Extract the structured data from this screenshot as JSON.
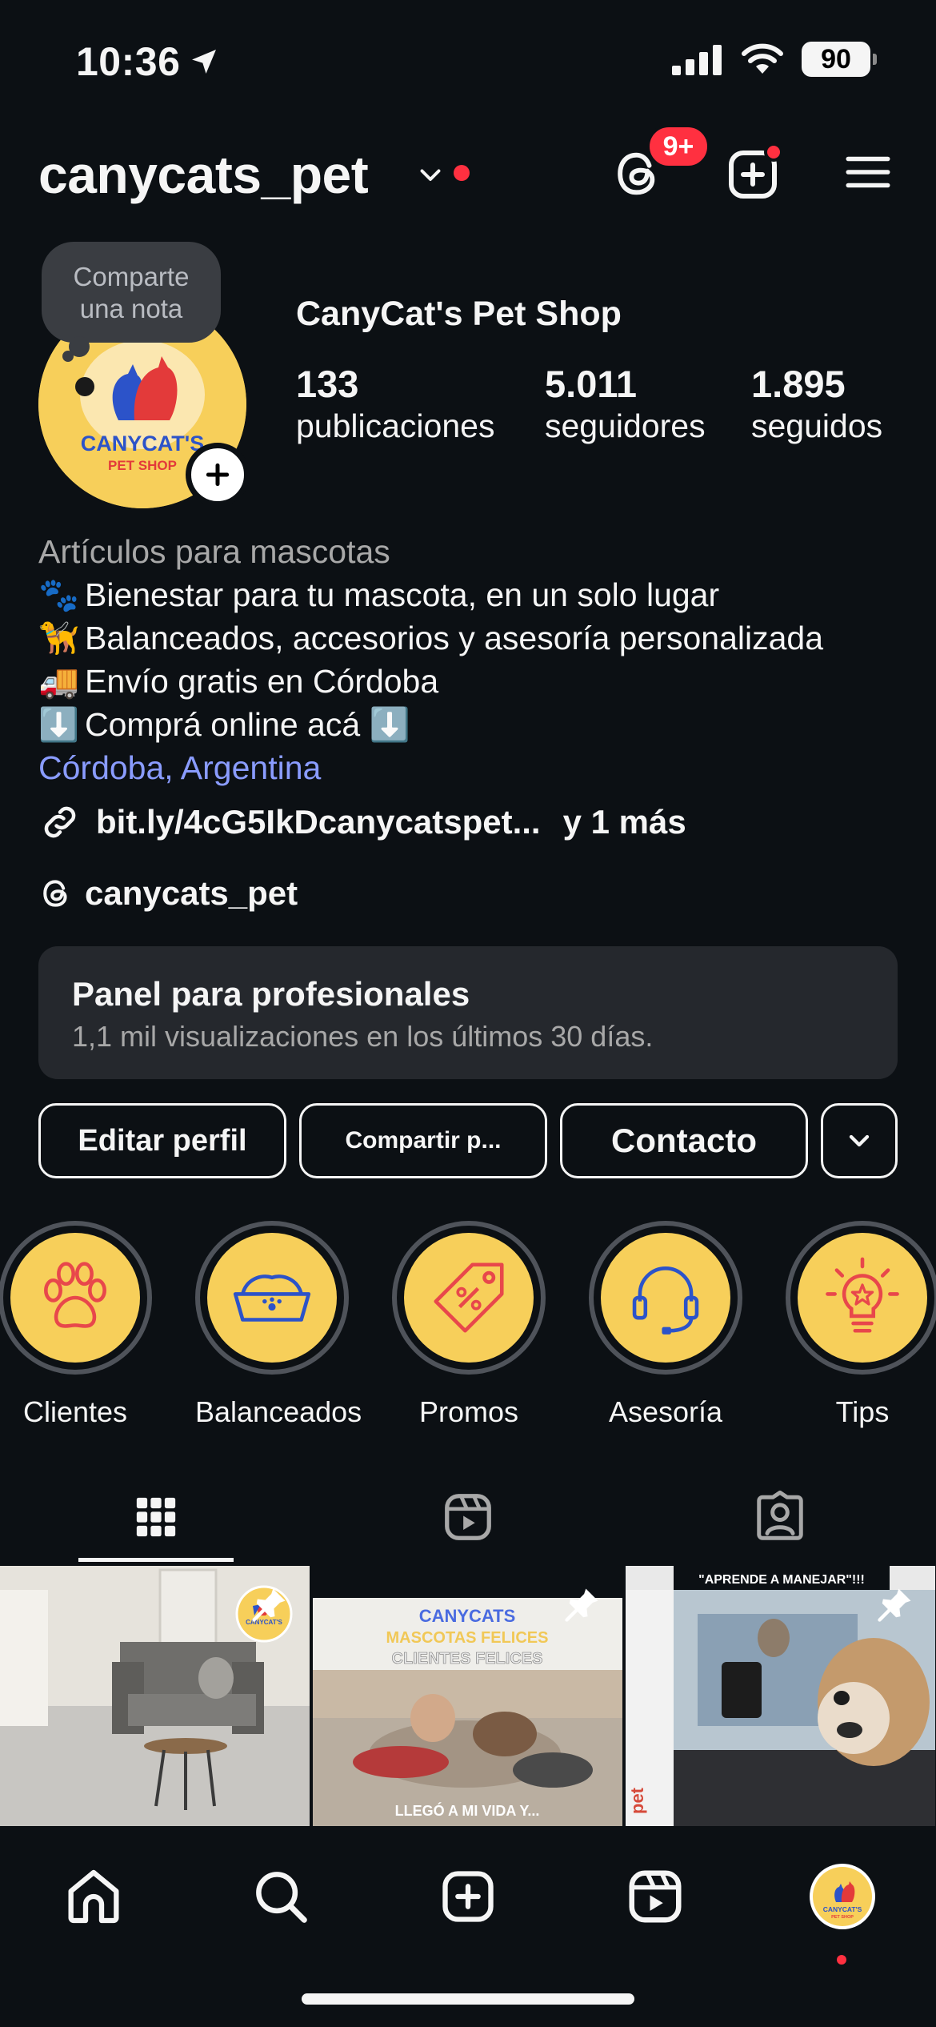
{
  "status_bar": {
    "time": "10:36",
    "battery": "90"
  },
  "header": {
    "username": "canycats_pet",
    "threads_badge": "9+"
  },
  "profile": {
    "note_line1": "Comparte",
    "note_line2": "una nota",
    "avatar_text1": "CANYCAT'S",
    "avatar_text2": "PET SHOP",
    "display_name": "CanyCat's Pet Shop",
    "stats": [
      {
        "value": "133",
        "label": "publicaciones"
      },
      {
        "value": "5.011",
        "label": "seguidores"
      },
      {
        "value": "1.895",
        "label": "seguidos"
      }
    ],
    "category": "Artículos para mascotas",
    "bio_lines": [
      {
        "emoji": "🐾",
        "text": "Bienestar para tu mascota, en un solo lugar"
      },
      {
        "emoji": "🦮",
        "text": "Balanceados, accesorios y asesoría personalizada"
      },
      {
        "emoji": "🚚",
        "text": "Envío gratis en Córdoba"
      },
      {
        "emoji": "⬇️",
        "text": "Comprá online acá ⬇️"
      }
    ],
    "location": "Córdoba, Argentina",
    "link": "bit.ly/4cG5IkDcanycatspet...",
    "link_more": "y 1 más",
    "threads_handle": "canycats_pet"
  },
  "pro_panel": {
    "title": "Panel para profesionales",
    "subtitle": "1,1 mil visualizaciones en los últimos 30 días."
  },
  "buttons": {
    "edit": "Editar perfil",
    "share": "Compartir p...",
    "contact": "Contacto"
  },
  "highlights": [
    {
      "label": "Clientes",
      "icon": "paw-icon"
    },
    {
      "label": "Balanceados",
      "icon": "pet-bowl-icon"
    },
    {
      "label": "Promos",
      "icon": "price-tag-icon"
    },
    {
      "label": "Asesoría",
      "icon": "headset-icon"
    },
    {
      "label": "Tips",
      "icon": "lightbulb-icon"
    }
  ],
  "grid": {
    "post2_line1": "CANYCATS",
    "post2_line2": "MASCOTAS FELICES",
    "post2_line3": "CLIENTES FELICES",
    "post2_caption": "LLEGÓ A MI VIDA Y...",
    "post3_caption": "\"APRENDE A MANEJAR\"!!!",
    "post3_side": "pet"
  },
  "colors": {
    "accent_red": "#ff3040",
    "brand_yellow": "#f7cf5a",
    "link_blue": "#8a9cff",
    "background": "#0c1014"
  }
}
